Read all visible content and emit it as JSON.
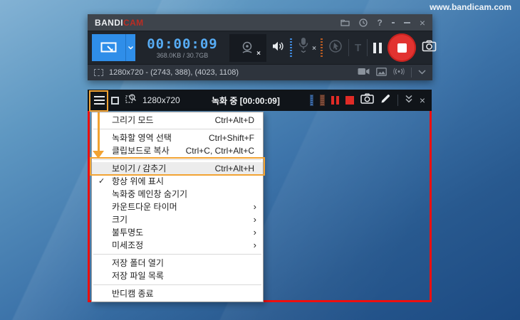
{
  "watermark": "www.bandicam.com",
  "colors": {
    "accent_orange": "#f2a333",
    "capture_red": "#ee0f0f",
    "record_red": "#e23330",
    "timer_blue": "#57acf4",
    "button_blue": "#2f8ee9"
  },
  "main_window": {
    "logo": {
      "white": "BANDI",
      "red": "CAM"
    },
    "titlebar": {
      "help": "?",
      "close": "×"
    },
    "toolbar": {
      "timer": "00:00:09",
      "usage": "368.0KB / 30.7GB",
      "text_tool": "T",
      "webcam_off_mark": "×",
      "mic_off_mark": "×"
    },
    "statusbar": {
      "region": "1280x720 - (2743, 388), (4023, 1108)"
    }
  },
  "rec_bar": {
    "resolution": "1280x720",
    "status": "녹화 중 [00:00:09]",
    "close": "×"
  },
  "menu": {
    "checkmark": "✓",
    "submenu_arrow": "›",
    "items": [
      {
        "label": "그리기 모드",
        "shortcut": "Ctrl+Alt+D"
      },
      {
        "label": "녹화할 영역 선택",
        "shortcut": "Ctrl+Shift+F"
      },
      {
        "label": "클립보드로 복사",
        "shortcut": "Ctrl+C, Ctrl+Alt+C"
      },
      {
        "label": "보이기 / 감추기",
        "shortcut": "Ctrl+Alt+H",
        "highlighted": true
      },
      {
        "label": "항상 위에 표시",
        "checked": true
      },
      {
        "label": "녹화중 메인창 숨기기"
      },
      {
        "label": "카운트다운 타이머",
        "submenu": true
      },
      {
        "label": "크기",
        "submenu": true
      },
      {
        "label": "불투명도",
        "submenu": true
      },
      {
        "label": "미세조정",
        "submenu": true
      },
      {
        "label": "저장 폴더 열기"
      },
      {
        "label": "저장 파일 목록"
      },
      {
        "label": "반디캠 종료"
      }
    ]
  }
}
